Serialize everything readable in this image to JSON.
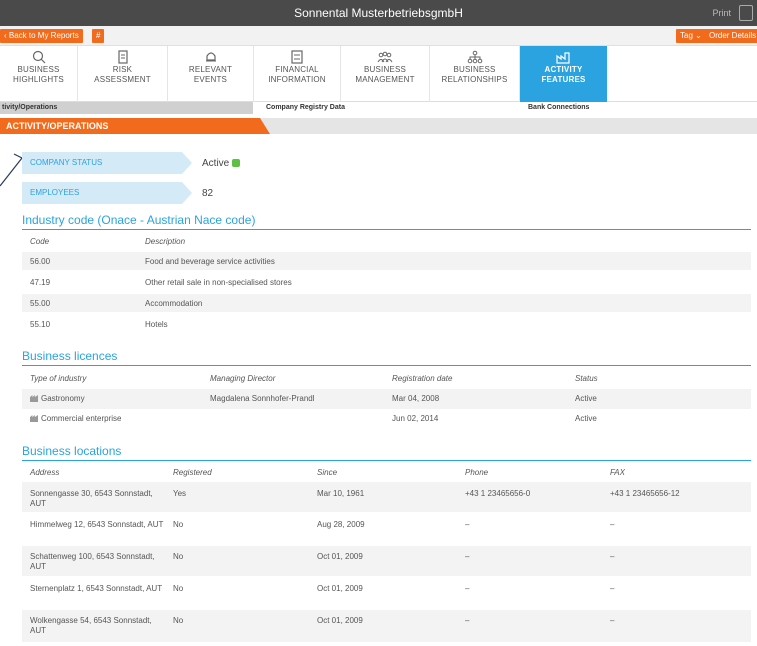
{
  "header": {
    "title": "Sonnental MusterbetriebsgmbH",
    "print_label": "Print"
  },
  "actions": {
    "back_label": "Back to My Reports",
    "hash_label": "#",
    "tag_label": "Tag ⌄",
    "order_label": "Order Details"
  },
  "nav": [
    {
      "line1": "BUSINESS",
      "line2": "HIGHLIGHTS",
      "icon": "search-icon"
    },
    {
      "line1": "RISK",
      "line2": "ASSESSMENT",
      "icon": "clipboard-icon"
    },
    {
      "line1": "RELEVANT",
      "line2": "EVENTS",
      "icon": "bell-icon"
    },
    {
      "line1": "FINANCIAL",
      "line2": "INFORMATION",
      "icon": "chart-icon"
    },
    {
      "line1": "BUSINESS",
      "line2": "MANAGEMENT",
      "icon": "people-icon"
    },
    {
      "line1": "BUSINESS",
      "line2": "RELATIONSHIPS",
      "icon": "network-icon"
    },
    {
      "line1": "ACTIVITY",
      "line2": "FEATURES",
      "icon": "factory-icon",
      "active": true
    }
  ],
  "subtabs": [
    "tivity/Operations",
    "Company Registry Data",
    "Bank Connections"
  ],
  "section": {
    "title": "ACTIVITY/OPERATIONS"
  },
  "status": {
    "company_status_label": "COMPANY STATUS",
    "company_status_value": "Active",
    "employees_label": "EMPLOYEES",
    "employees_value": "82"
  },
  "industry": {
    "title": "Industry code (Onace - Austrian Nace code)",
    "headers": [
      "Code",
      "Description"
    ],
    "rows": [
      [
        "56.00",
        "Food and beverage service activities"
      ],
      [
        "47.19",
        "Other retail sale in non-specialised stores"
      ],
      [
        "55.00",
        "Accommodation"
      ],
      [
        "55.10",
        "Hotels"
      ]
    ]
  },
  "licences": {
    "title": "Business licences",
    "headers": [
      "Type of industry",
      "Managing Director",
      "Registration date",
      "Status"
    ],
    "rows": [
      [
        "Gastronomy",
        "Magdalena Sonnhofer-Prandl",
        "Mar 04, 2008",
        "Active"
      ],
      [
        "Commercial enterprise",
        "",
        "Jun 02, 2014",
        "Active"
      ]
    ]
  },
  "locations": {
    "title": "Business locations",
    "headers": [
      "Address",
      "Registered",
      "Since",
      "Phone",
      "FAX"
    ],
    "rows": [
      [
        "Sonnengasse 30, 6543 Sonnstadt, AUT",
        "Yes",
        "Mar 10, 1961",
        "+43 1 23465656-0",
        "+43 1 23465656-12"
      ],
      [
        "Himmelweg 12, 6543 Sonnstadt, AUT",
        "No",
        "Aug 28, 2009",
        "–",
        "–"
      ],
      [
        "Schattenweg 100, 6543 Sonnstadt, AUT",
        "No",
        "Oct 01, 2009",
        "–",
        "–"
      ],
      [
        "Sternenplatz 1, 6543 Sonnstadt, AUT",
        "No",
        "Oct 01, 2009",
        "–",
        "–"
      ],
      [
        "Wolkengasse 54, 6543 Sonnstadt, AUT",
        "No",
        "Oct 01, 2009",
        "–",
        "–"
      ]
    ]
  },
  "colors": {
    "accent": "#2aa3e0",
    "orange": "#f26b1d",
    "status_green": "#5cc043"
  }
}
